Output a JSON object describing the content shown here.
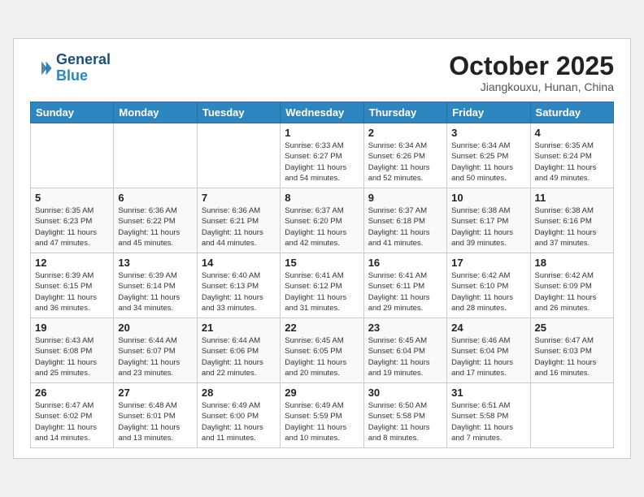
{
  "header": {
    "logo_line1": "General",
    "logo_line2": "Blue",
    "month": "October 2025",
    "location": "Jiangkouxu, Hunan, China"
  },
  "weekdays": [
    "Sunday",
    "Monday",
    "Tuesday",
    "Wednesday",
    "Thursday",
    "Friday",
    "Saturday"
  ],
  "weeks": [
    [
      {
        "day": "",
        "info": ""
      },
      {
        "day": "",
        "info": ""
      },
      {
        "day": "",
        "info": ""
      },
      {
        "day": "1",
        "info": "Sunrise: 6:33 AM\nSunset: 6:27 PM\nDaylight: 11 hours\nand 54 minutes."
      },
      {
        "day": "2",
        "info": "Sunrise: 6:34 AM\nSunset: 6:26 PM\nDaylight: 11 hours\nand 52 minutes."
      },
      {
        "day": "3",
        "info": "Sunrise: 6:34 AM\nSunset: 6:25 PM\nDaylight: 11 hours\nand 50 minutes."
      },
      {
        "day": "4",
        "info": "Sunrise: 6:35 AM\nSunset: 6:24 PM\nDaylight: 11 hours\nand 49 minutes."
      }
    ],
    [
      {
        "day": "5",
        "info": "Sunrise: 6:35 AM\nSunset: 6:23 PM\nDaylight: 11 hours\nand 47 minutes."
      },
      {
        "day": "6",
        "info": "Sunrise: 6:36 AM\nSunset: 6:22 PM\nDaylight: 11 hours\nand 45 minutes."
      },
      {
        "day": "7",
        "info": "Sunrise: 6:36 AM\nSunset: 6:21 PM\nDaylight: 11 hours\nand 44 minutes."
      },
      {
        "day": "8",
        "info": "Sunrise: 6:37 AM\nSunset: 6:20 PM\nDaylight: 11 hours\nand 42 minutes."
      },
      {
        "day": "9",
        "info": "Sunrise: 6:37 AM\nSunset: 6:18 PM\nDaylight: 11 hours\nand 41 minutes."
      },
      {
        "day": "10",
        "info": "Sunrise: 6:38 AM\nSunset: 6:17 PM\nDaylight: 11 hours\nand 39 minutes."
      },
      {
        "day": "11",
        "info": "Sunrise: 6:38 AM\nSunset: 6:16 PM\nDaylight: 11 hours\nand 37 minutes."
      }
    ],
    [
      {
        "day": "12",
        "info": "Sunrise: 6:39 AM\nSunset: 6:15 PM\nDaylight: 11 hours\nand 36 minutes."
      },
      {
        "day": "13",
        "info": "Sunrise: 6:39 AM\nSunset: 6:14 PM\nDaylight: 11 hours\nand 34 minutes."
      },
      {
        "day": "14",
        "info": "Sunrise: 6:40 AM\nSunset: 6:13 PM\nDaylight: 11 hours\nand 33 minutes."
      },
      {
        "day": "15",
        "info": "Sunrise: 6:41 AM\nSunset: 6:12 PM\nDaylight: 11 hours\nand 31 minutes."
      },
      {
        "day": "16",
        "info": "Sunrise: 6:41 AM\nSunset: 6:11 PM\nDaylight: 11 hours\nand 29 minutes."
      },
      {
        "day": "17",
        "info": "Sunrise: 6:42 AM\nSunset: 6:10 PM\nDaylight: 11 hours\nand 28 minutes."
      },
      {
        "day": "18",
        "info": "Sunrise: 6:42 AM\nSunset: 6:09 PM\nDaylight: 11 hours\nand 26 minutes."
      }
    ],
    [
      {
        "day": "19",
        "info": "Sunrise: 6:43 AM\nSunset: 6:08 PM\nDaylight: 11 hours\nand 25 minutes."
      },
      {
        "day": "20",
        "info": "Sunrise: 6:44 AM\nSunset: 6:07 PM\nDaylight: 11 hours\nand 23 minutes."
      },
      {
        "day": "21",
        "info": "Sunrise: 6:44 AM\nSunset: 6:06 PM\nDaylight: 11 hours\nand 22 minutes."
      },
      {
        "day": "22",
        "info": "Sunrise: 6:45 AM\nSunset: 6:05 PM\nDaylight: 11 hours\nand 20 minutes."
      },
      {
        "day": "23",
        "info": "Sunrise: 6:45 AM\nSunset: 6:04 PM\nDaylight: 11 hours\nand 19 minutes."
      },
      {
        "day": "24",
        "info": "Sunrise: 6:46 AM\nSunset: 6:04 PM\nDaylight: 11 hours\nand 17 minutes."
      },
      {
        "day": "25",
        "info": "Sunrise: 6:47 AM\nSunset: 6:03 PM\nDaylight: 11 hours\nand 16 minutes."
      }
    ],
    [
      {
        "day": "26",
        "info": "Sunrise: 6:47 AM\nSunset: 6:02 PM\nDaylight: 11 hours\nand 14 minutes."
      },
      {
        "day": "27",
        "info": "Sunrise: 6:48 AM\nSunset: 6:01 PM\nDaylight: 11 hours\nand 13 minutes."
      },
      {
        "day": "28",
        "info": "Sunrise: 6:49 AM\nSunset: 6:00 PM\nDaylight: 11 hours\nand 11 minutes."
      },
      {
        "day": "29",
        "info": "Sunrise: 6:49 AM\nSunset: 5:59 PM\nDaylight: 11 hours\nand 10 minutes."
      },
      {
        "day": "30",
        "info": "Sunrise: 6:50 AM\nSunset: 5:58 PM\nDaylight: 11 hours\nand 8 minutes."
      },
      {
        "day": "31",
        "info": "Sunrise: 6:51 AM\nSunset: 5:58 PM\nDaylight: 11 hours\nand 7 minutes."
      },
      {
        "day": "",
        "info": ""
      }
    ]
  ]
}
